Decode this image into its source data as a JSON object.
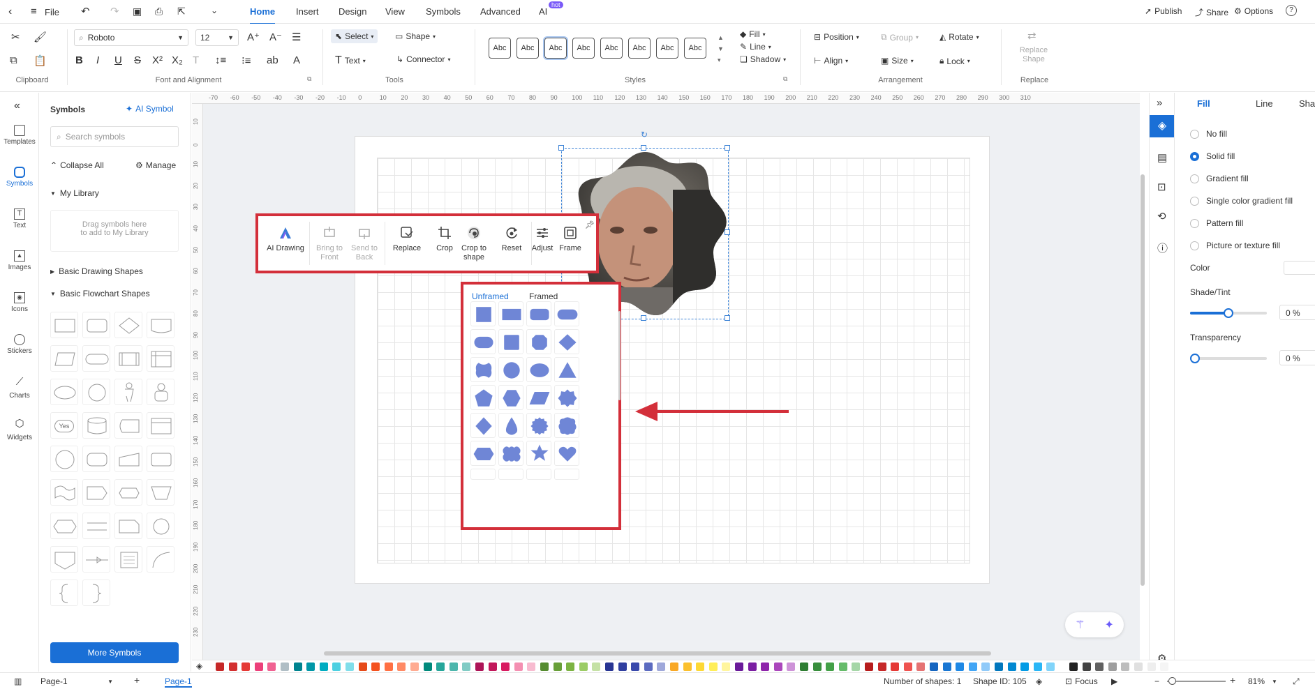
{
  "menu": {
    "file": "File",
    "tabs": [
      "Home",
      "Insert",
      "Design",
      "View",
      "Symbols",
      "Advanced",
      "AI"
    ],
    "hot_badge": "hot",
    "publish": "Publish",
    "share": "Share",
    "options": "Options",
    "help": "?"
  },
  "ribbon": {
    "font_name": "Roboto",
    "font_size": "12",
    "select": "Select",
    "shape": "Shape",
    "text": "Text",
    "connector": "Connector",
    "style_labels": [
      "Abc",
      "Abc",
      "Abc",
      "Abc",
      "Abc",
      "Abc",
      "Abc",
      "Abc"
    ],
    "fill": "Fill",
    "line": "Line",
    "shadow": "Shadow",
    "position": "Position",
    "group": "Group",
    "rotate": "Rotate",
    "align": "Align",
    "size": "Size",
    "lock": "Lock",
    "replace_shape": "Replace Shape",
    "groups": {
      "clipboard": "Clipboard",
      "font_alignment": "Font and Alignment",
      "tools": "Tools",
      "styles": "Styles",
      "arrangement": "Arrangement",
      "replace": "Replace"
    }
  },
  "rail": [
    {
      "label": "Templates",
      "icon": "templates-icon"
    },
    {
      "label": "Symbols",
      "icon": "symbols-icon"
    },
    {
      "label": "Text",
      "icon": "text-icon"
    },
    {
      "label": "Images",
      "icon": "images-icon"
    },
    {
      "label": "Icons",
      "icon": "icons-icon"
    },
    {
      "label": "Stickers",
      "icon": "stickers-icon"
    },
    {
      "label": "Charts",
      "icon": "charts-icon"
    },
    {
      "label": "Widgets",
      "icon": "widgets-icon"
    }
  ],
  "symbols_panel": {
    "title": "Symbols",
    "ai_symbol": "AI Symbol",
    "search_placeholder": "Search symbols",
    "collapse_all": "Collapse All",
    "manage": "Manage",
    "my_library": "My Library",
    "drop_hint_1": "Drag symbols here",
    "drop_hint_2": "to add to My Library",
    "basic_drawing": "Basic Drawing Shapes",
    "basic_flowchart": "Basic Flowchart Shapes",
    "yes_label": "Yes",
    "more_symbols": "More Symbols"
  },
  "ruler": {
    "h_ticks": [
      "-70",
      "-60",
      "-50",
      "-40",
      "-30",
      "-20",
      "-10",
      "0",
      "10",
      "20",
      "30",
      "40",
      "50",
      "60",
      "70",
      "80",
      "90",
      "100",
      "110",
      "120",
      "130",
      "140",
      "150",
      "160",
      "170",
      "180",
      "190",
      "200",
      "210",
      "220",
      "230",
      "240",
      "250",
      "260",
      "270",
      "280",
      "290",
      "300",
      "310"
    ],
    "v_ticks": [
      "10",
      "0",
      "10",
      "20",
      "30",
      "40",
      "50",
      "60",
      "70",
      "80",
      "90",
      "100",
      "110",
      "120",
      "130",
      "140",
      "150",
      "160",
      "170",
      "180",
      "190",
      "200",
      "210",
      "220",
      "230"
    ]
  },
  "float_toolbar": {
    "items": [
      {
        "label": "AI Drawing",
        "icon": "ai-drawing-icon",
        "enabled": true
      },
      {
        "label": "Bring to Front",
        "icon": "bring-to-front-icon",
        "enabled": false
      },
      {
        "label": "Send to Back",
        "icon": "send-to-back-icon",
        "enabled": false
      },
      {
        "label": "Replace",
        "icon": "replace-icon",
        "enabled": true
      },
      {
        "label": "Crop",
        "icon": "crop-icon",
        "enabled": true
      },
      {
        "label": "Crop to shape",
        "icon": "crop-to-shape-icon",
        "enabled": true
      },
      {
        "label": "Reset",
        "icon": "reset-icon",
        "enabled": true
      },
      {
        "label": "Adjust",
        "icon": "adjust-icon",
        "enabled": true
      },
      {
        "label": "Frame",
        "icon": "frame-icon",
        "enabled": true
      }
    ]
  },
  "shape_panel": {
    "tab_unframed": "Unframed",
    "tab_framed": "Framed"
  },
  "right_panel": {
    "tab_fill": "Fill",
    "tab_line": "Line",
    "tab_shadow": "Shac",
    "fill_options": [
      "No fill",
      "Solid fill",
      "Gradient fill",
      "Single color gradient fill",
      "Pattern fill",
      "Picture or texture fill"
    ],
    "selected_fill": "Solid fill",
    "color": "Color",
    "shade_tint": "Shade/Tint",
    "shade_value": "0 %",
    "shade_level": 0.5,
    "transparency": "Transparency",
    "transparency_value": "0 %",
    "transparency_level": 0
  },
  "status": {
    "page_selector": "Page-1",
    "page_tab": "Page-1",
    "shape_count": "Number of shapes: 1",
    "shape_id": "Shape ID: 105",
    "focus": "Focus",
    "zoom": "81%"
  },
  "colors": {
    "accent": "#1a6fd6",
    "highlight_red": "#d32f3a",
    "shape_fill": "#6f86d6",
    "palette": [
      "#c62828",
      "#d32f2f",
      "#e53935",
      "#ec407a",
      "#f06292",
      "#b0bec5",
      "#00838f",
      "#0097a7",
      "#00acc1",
      "#4dd0e1",
      "#80deea",
      "#e64a19",
      "#f4511e",
      "#ff7043",
      "#ff8a65",
      "#ffab91",
      "#00897b",
      "#26a69a",
      "#4db6ac",
      "#80cbc4",
      "#ad1457",
      "#c2185b",
      "#d81b60",
      "#f48fb1",
      "#f8bbd0",
      "#558b2f",
      "#689f38",
      "#7cb342",
      "#9ccc65",
      "#c5e1a5",
      "#283593",
      "#303f9f",
      "#3949ab",
      "#5c6bc0",
      "#9fa8da",
      "#f9a825",
      "#fbc02d",
      "#fdd835",
      "#ffee58",
      "#fff59d",
      "#6a1b9a",
      "#7b1fa2",
      "#8e24aa",
      "#ab47bc",
      "#ce93d8",
      "#2e7d32",
      "#388e3c",
      "#43a047",
      "#66bb6a",
      "#a5d6a7",
      "#b71c1c",
      "#c62828",
      "#e53935",
      "#ef5350",
      "#e57373",
      "#1565c0",
      "#1976d2",
      "#1e88e5",
      "#42a5f5",
      "#90caf9",
      "#0277bd",
      "#0288d1",
      "#039be5",
      "#29b6f6",
      "#81d4fa",
      "#212121",
      "#424242",
      "#616161",
      "#9e9e9e",
      "#bdbdbd",
      "#e0e0e0",
      "#eeeeee",
      "#f5f5f5"
    ]
  }
}
